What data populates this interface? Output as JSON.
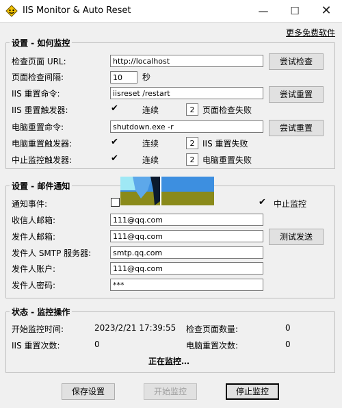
{
  "window": {
    "title": "IIS Monitor & Auto Reset",
    "minimize_glyph": "—",
    "maximize_glyph": "☐",
    "close_glyph": "✕"
  },
  "more_software_link": "更多免费软件",
  "monitor_group": {
    "title": "设置 - 如何监控",
    "url_label": "检查页面 URL:",
    "url_value": "http://localhost",
    "try_check_button": "尝试检查",
    "interval_label": "页面检查间隔:",
    "interval_value": "10",
    "interval_unit": "秒",
    "iis_reset_cmd_label": "IIS 重置命令:",
    "iis_reset_cmd_value": "iisreset /restart",
    "try_reset_button": "尝试重置",
    "iis_trigger_label": "IIS 重置触发器:",
    "iis_trigger_checked": "✔",
    "iis_trigger_consecutive": "连续",
    "iis_trigger_count": "2",
    "iis_trigger_suffix": "页面检查失败",
    "pc_reset_cmd_label": "电脑重置命令:",
    "pc_reset_cmd_value": "shutdown.exe -r",
    "try_pc_reset_button": "尝试重置",
    "pc_trigger_label": "电脑重置触发器:",
    "pc_trigger_checked": "✔",
    "pc_trigger_consecutive": "连续",
    "pc_trigger_count": "2",
    "pc_trigger_suffix": "IIS 重置失败",
    "stop_trigger_label": "中止监控触发器:",
    "stop_trigger_checked": "✔",
    "stop_trigger_consecutive": "连续",
    "stop_trigger_count": "2",
    "stop_trigger_suffix": "电脑重置失败"
  },
  "mail_group": {
    "title": "设置 - 邮件通知",
    "events_label": "通知事件:",
    "stop_monitor_checked": "✔",
    "stop_monitor_label": "中止监控",
    "recipient_label": "收信人邮箱:",
    "recipient_value": "111@qq.com",
    "sender_label": "发件人邮箱:",
    "sender_value": "111@qq.com",
    "test_send_button": "测试发送",
    "smtp_label": "发件人 SMTP 服务器:",
    "smtp_value": "smtp.qq.com",
    "account_label": "发件人账户:",
    "account_value": "111@qq.com",
    "password_label": "发件人密码:",
    "password_value": "***"
  },
  "status_group": {
    "title": "状态 - 监控操作",
    "start_time_label": "开始监控时间:",
    "start_time_value": "2023/2/21 17:39:55",
    "pages_checked_label": "检查页面数量:",
    "pages_checked_value": "0",
    "iis_resets_label": "IIS 重置次数:",
    "iis_resets_value": "0",
    "pc_resets_label": "电脑重置次数:",
    "pc_resets_value": "0",
    "status_text": "正在监控…"
  },
  "buttons": {
    "save": "保存设置",
    "start": "开始监控",
    "stop": "停止监控"
  },
  "colors": {
    "overlay_sky": "#3d8fe0",
    "overlay_ground": "#8a8a1a",
    "overlay_cyan": "#9fe8f5"
  }
}
